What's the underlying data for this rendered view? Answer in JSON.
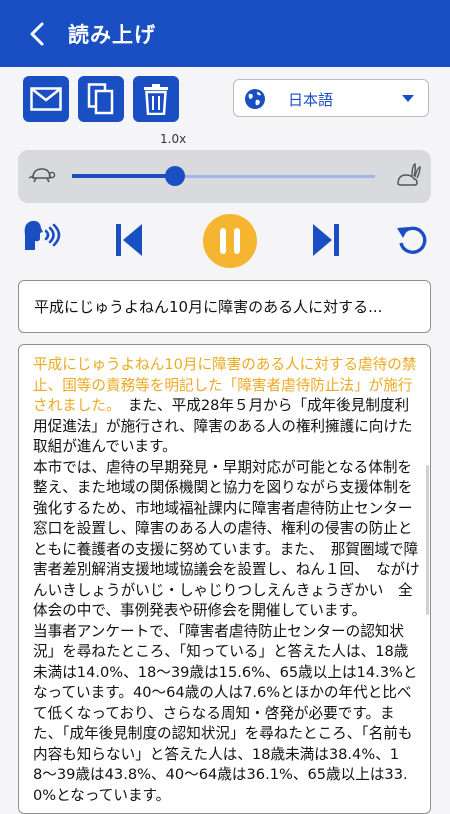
{
  "header": {
    "title": "読み上げ"
  },
  "toolbar": {
    "mail_icon": "mail-icon",
    "copy_icon": "copy-icon",
    "delete_icon": "trash-icon"
  },
  "language": {
    "selected": "日本語",
    "icon": "globe-icon"
  },
  "speed": {
    "label": "1.0x",
    "level": 0.34
  },
  "controls": {
    "voice": "speak-icon",
    "previous": "skip-previous-icon",
    "pause": "pause-icon",
    "next": "skip-next-icon",
    "repeat": "repeat-icon"
  },
  "current_sentence": "平成にじゅうよねん10月に障害のある人に対する...",
  "reading_text": {
    "highlighted": "平成にじゅうよねん10月に障害のある人に対する虐待の禁止、国等の責務等を明記した「障害者虐待防止法」が施行されました。",
    "rest": "　また、平成28年５月から「成年後見制度利用促進法」が施行され、障害のある人の権利擁護に向けた取組が進んでいます。\n本市では、虐待の早期発見・早期対応が可能となる体制を整え、また地域の関係機関と協力を図りながら支援体制を強化するため、市地域福祉課内に障害者虐待防止センター窓口を設置し、障害のある人の虐待、権利の侵害の防止とともに養護者の支援に努めています。また、　那賀圏域で障害者差別解消支援地域協議会を設置し、ねん１回、　ながけんいきしょうがいじ・しゃじりつしえんきょうぎかい　全体会の中で、事例発表や研修会を開催しています。\n当事者アンケートで、「障害者虐待防止センターの認知状況」を尋ねたところ、「知っている」と答えた人は、18歳未満は14.0%、18〜39歳は15.6%、65歳以上は14.3%となっています。40〜64歳の人は7.6%とほかの年代と比べて低くなっており、さらなる周知・啓発が必要です。また、「成年後見制度の認知状況」を尋ねたところ、「名前も内容も知らない」と答えた人は、18歳未満は38.4%、18〜39歳は43.8%、40〜64歳は36.1%、65歳以上は33.0%となっています。"
  },
  "colors": {
    "primary": "#1a4fc4",
    "highlight": "#eda920",
    "pause_button": "#f5b531"
  }
}
